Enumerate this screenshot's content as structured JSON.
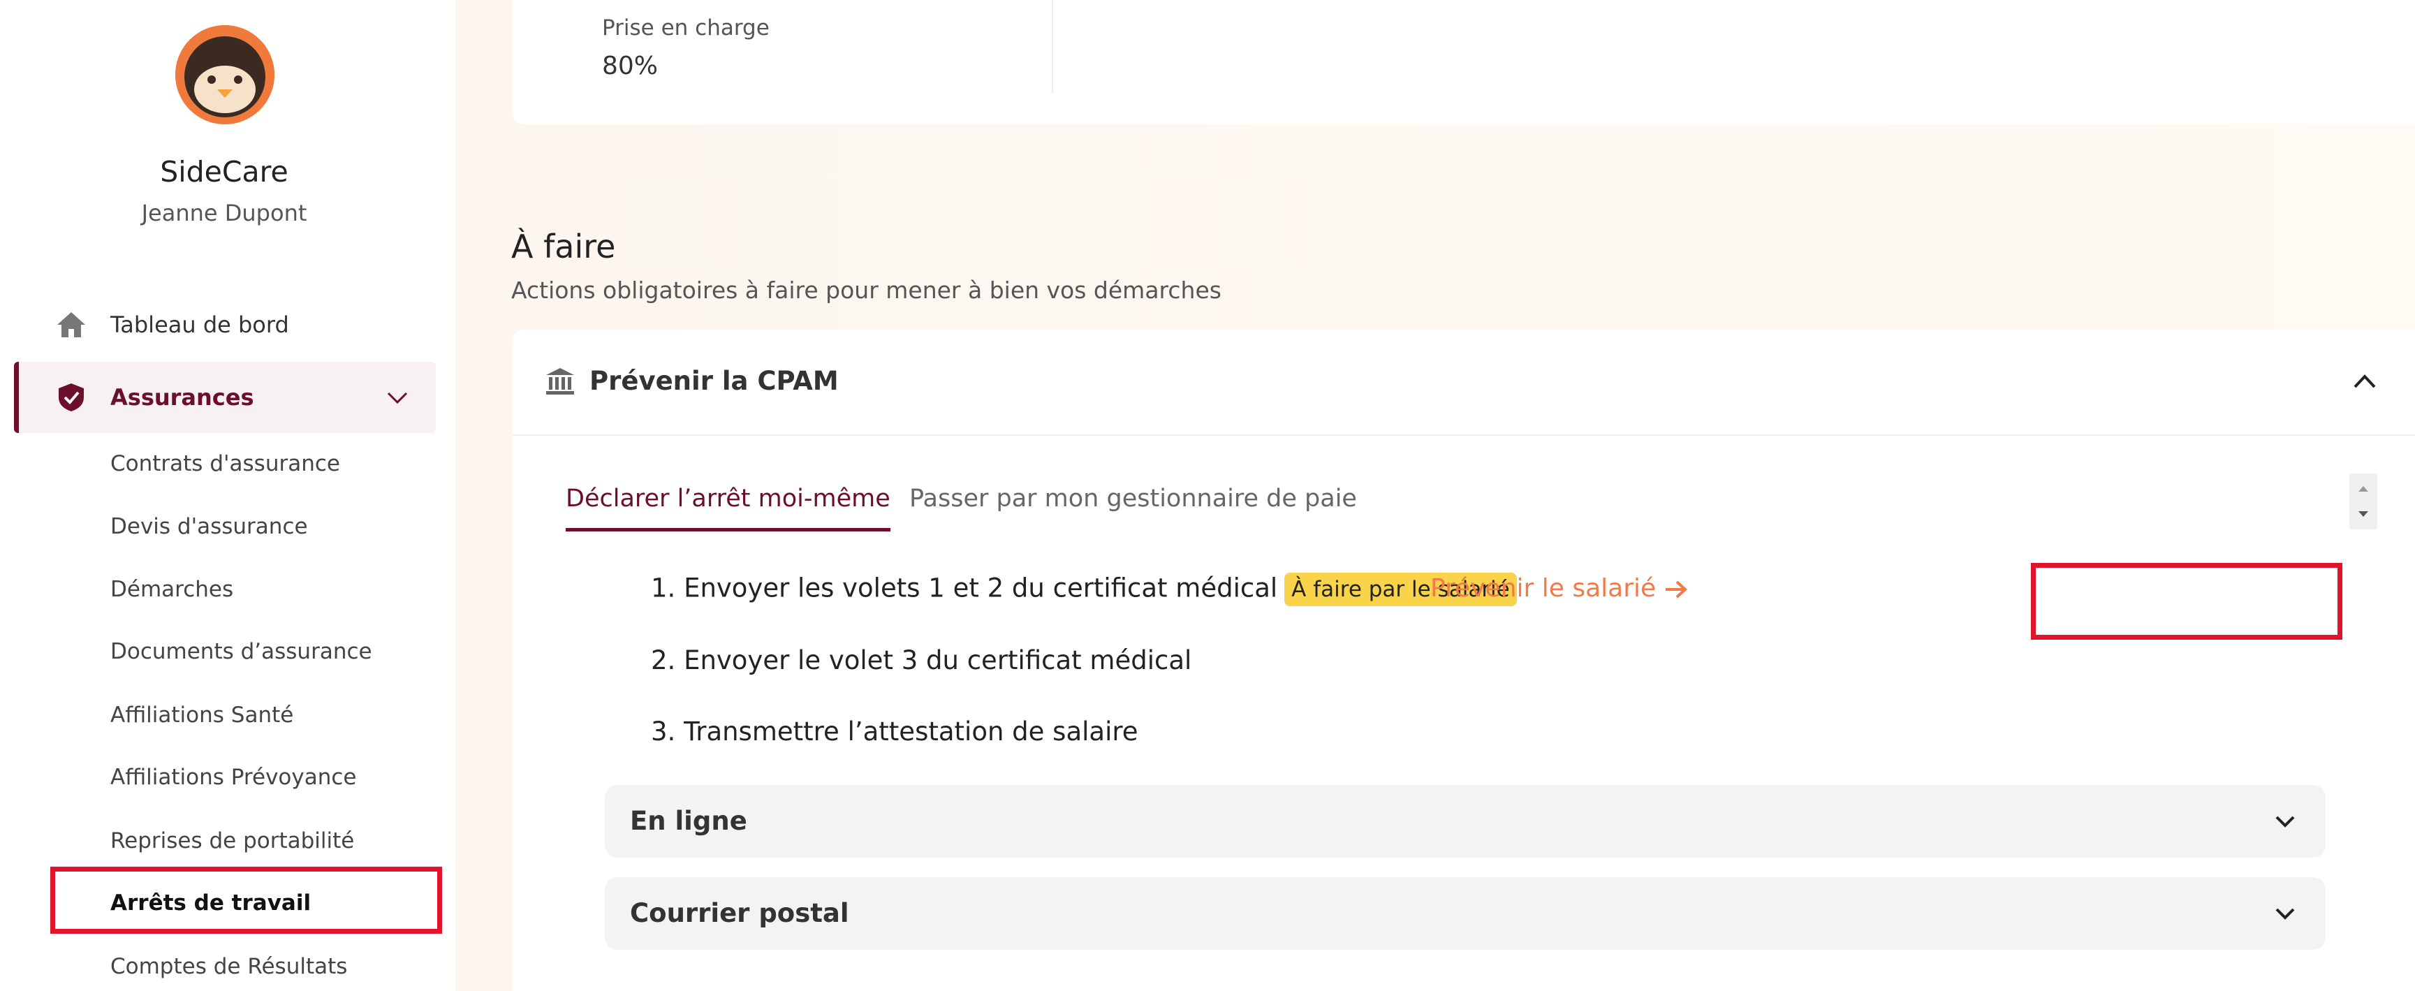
{
  "sidebar": {
    "brand": "SideCare",
    "user": "Jeanne Dupont",
    "nav": {
      "dashboard": "Tableau de bord",
      "assurances": "Assurances"
    },
    "sub_items": [
      "Contrats d'assurance",
      "Devis d'assurance",
      "Démarches",
      "Documents d’assurance",
      "Affiliations Santé",
      "Affiliations Prévoyance",
      "Reprises de portabilité",
      "Arrêts de travail",
      "Comptes de Résultats"
    ],
    "active_sub_item": "Arrêts de travail"
  },
  "main": {
    "prise_en_charge": {
      "label": "Prise en charge",
      "value": "80%"
    },
    "todo": {
      "title": "À faire",
      "subtitle": "Actions obligatoires à faire pour mener à bien vos démarches",
      "card_title": "Prévenir la CPAM",
      "tabs": [
        {
          "label": "Déclarer l’arrêt moi-même",
          "active": true
        },
        {
          "label": "Passer par mon gestionnaire de paie",
          "active": false
        }
      ],
      "steps": [
        "1. Envoyer les volets 1 et 2 du certificat médical",
        "2. Envoyer le volet 3 du certificat médical",
        "3. Transmettre l’attestation de salaire"
      ],
      "step1_badge": "À faire par le salarié",
      "notify_link": "Prévenir le salarié",
      "accordions": [
        "En ligne",
        "Courrier postal"
      ]
    }
  },
  "colors": {
    "brand": "#6b0f2b",
    "accent": "#f07a4a",
    "badge": "#f9d34a",
    "highlight": "#e0142a"
  },
  "icons": {
    "dashboard": "home-icon",
    "assurances": "shield-check-icon",
    "card": "bank-icon"
  }
}
